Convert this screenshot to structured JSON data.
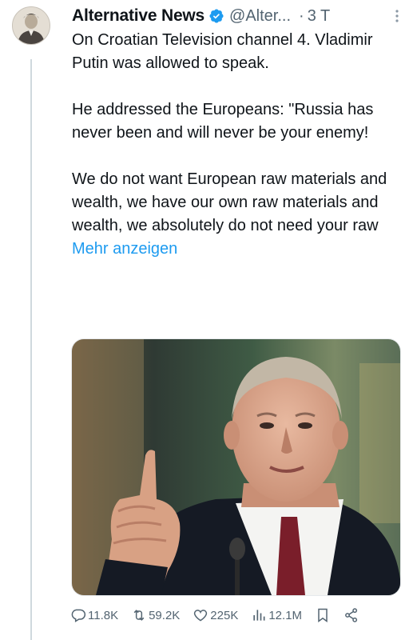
{
  "tweet": {
    "author": {
      "display_name": "Alternative News",
      "handle": "@Alter...",
      "separator": "·",
      "time": "3 T",
      "verified": true,
      "avatar_icon": "user-avatar"
    },
    "paragraphs": [
      "On Croatian Television channel 4. Vladimir Putin was allowed to speak.",
      "He addressed the Europeans: \"Russia has never been and will never be your enemy!",
      "We do not want European raw materials and wealth, we have our own raw materials and wealth, we absolutely do not need your raw"
    ],
    "show_more_label": "Mehr anzeigen",
    "media": {
      "type": "photo",
      "subject_icon": "person-pointing-finger"
    },
    "actions": {
      "replies": "11.8K",
      "reposts": "59.2K",
      "likes": "225K",
      "views": "12.1M"
    },
    "colors": {
      "accent": "#1d9bf0",
      "text": "#0f1419",
      "secondary_text": "#536471"
    }
  }
}
